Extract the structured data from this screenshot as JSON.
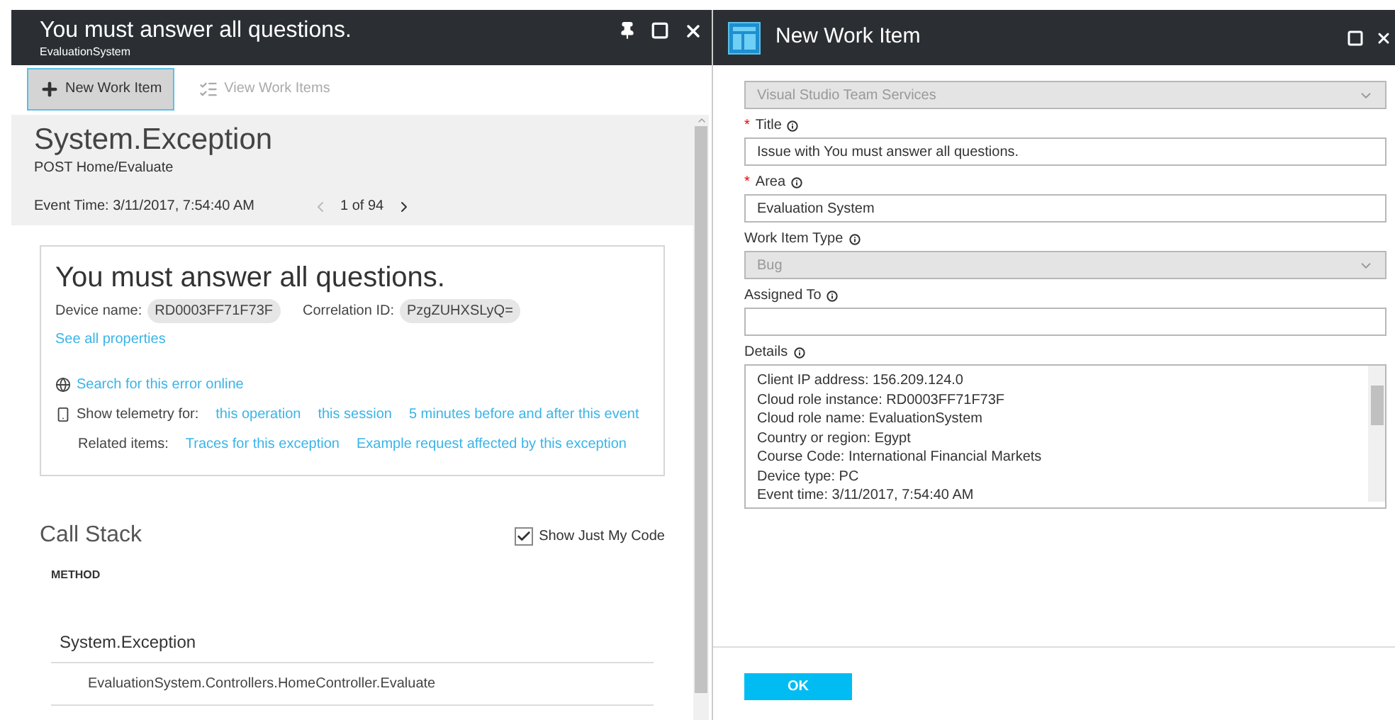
{
  "left_blade": {
    "title": "You must answer all questions.",
    "subtitle": "EvaluationSystem",
    "toolbar": [
      {
        "label": "New Work Item",
        "kind": "plus",
        "selected": true,
        "disabled": false
      },
      {
        "label": "View Work Items",
        "kind": "list",
        "selected": false,
        "disabled": true
      }
    ],
    "exception": {
      "type": "System.Exception",
      "operation": "POST Home/Evaluate",
      "event_time": "Event Time: 3/11/2017, 7:54:40 AM",
      "pager": "1 of 94"
    },
    "card": {
      "message": "You must answer all questions.",
      "properties": [
        {
          "label": "Device name:",
          "value": "RD0003FF71F73F"
        },
        {
          "label": "Correlation ID:",
          "value": "PzgZUHXSLyQ="
        }
      ],
      "see_all": "See all properties",
      "search_link": "Search for this error online",
      "telemetry_label": "Show telemetry for:",
      "telemetry_links": [
        "this operation",
        "this session",
        "5 minutes before and after this event"
      ],
      "related_label": "Related items:",
      "related_links": [
        "Traces for this exception",
        "Example request affected by this exception"
      ]
    },
    "call_stack": {
      "title": "Call Stack",
      "just_my_code": {
        "label": "Show Just My Code",
        "checked": true
      },
      "column": "METHOD",
      "rows": [
        {
          "text": "System.Exception",
          "kind": "exception"
        },
        {
          "text": "EvaluationSystem.Controllers.HomeController.Evaluate",
          "kind": "frame"
        }
      ]
    }
  },
  "right_blade": {
    "title": "New Work Item",
    "fields": [
      {
        "kind": "select",
        "value": "Visual Studio Team Services",
        "disabled": true
      },
      {
        "kind": "input",
        "label": "Title",
        "required_mark": "*",
        "value": "Issue with You must answer all questions."
      },
      {
        "kind": "input",
        "label": "Area",
        "required_mark": "*",
        "value": "Evaluation System"
      },
      {
        "kind": "select",
        "label": "Work Item Type",
        "value": "Bug",
        "disabled": true
      },
      {
        "kind": "input",
        "label": "Assigned To"
      },
      {
        "kind": "textarea",
        "label": "Details",
        "lines": [
          "Client IP address: 156.209.124.0",
          "Cloud role instance: RD0003FF71F73F",
          "Cloud role name: EvaluationSystem",
          "Country or region: Egypt",
          "Course Code: International Financial Markets",
          "Device type: PC",
          "Event time: 3/11/2017, 7:54:40 AM"
        ]
      }
    ],
    "ok": "OK"
  }
}
